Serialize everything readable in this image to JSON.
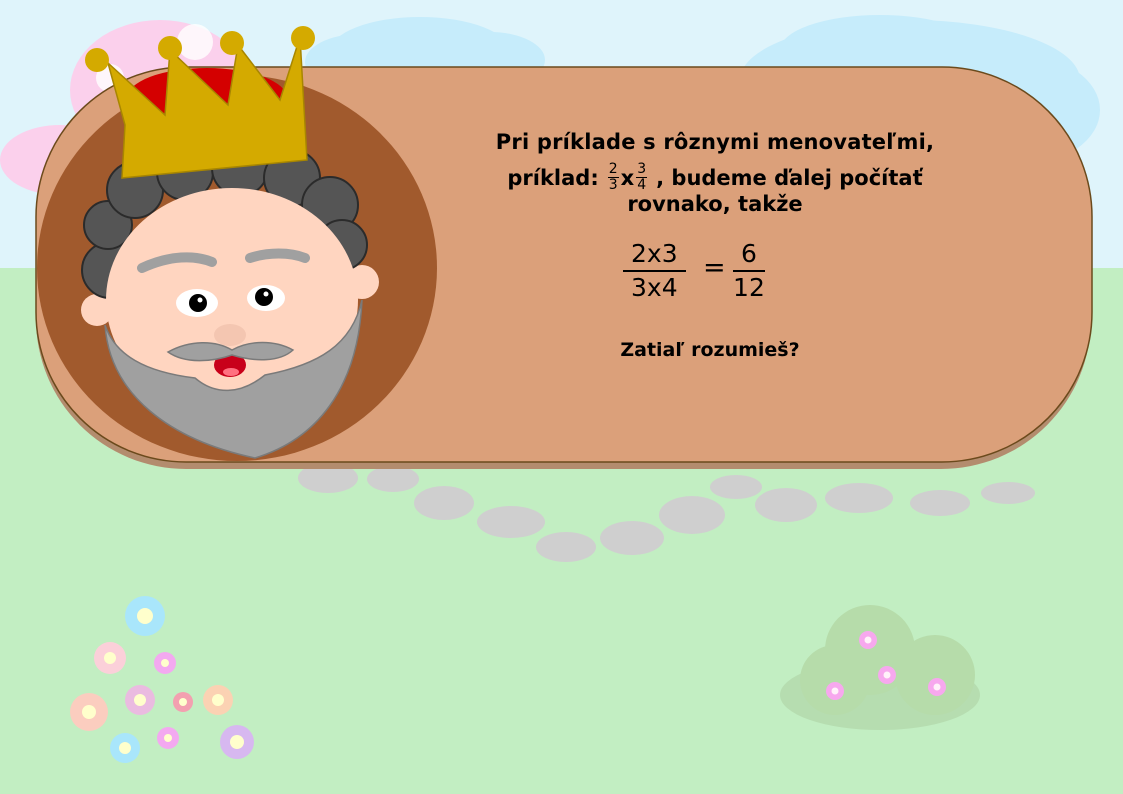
{
  "bubble": {
    "line1": "Pri príklade s rôznymi menovateľmi,",
    "line2_prefix": "príklad:",
    "example_fraction_a": {
      "numerator": "2",
      "denominator": "3"
    },
    "operator": "x",
    "example_fraction_b": {
      "numerator": "3",
      "denominator": "4"
    },
    "line2_suffix": ", budeme ďalej počítať",
    "line3": "rovnako, takže",
    "equation": {
      "left": {
        "numerator": "2x3",
        "denominator": "3x4"
      },
      "equals": "=",
      "right": {
        "numerator": "6",
        "denominator": "12"
      }
    },
    "question": "Zatiaľ rozumieš?"
  },
  "colors": {
    "sky": "#dff4fb",
    "grass": "#c2eec2",
    "bubble": "#dba07a",
    "bubble_shadow": "#b38c6e",
    "medallion": "#a15a2d",
    "crown": "#d4aa00",
    "crown_velvet": "#d40000",
    "hair": "#555555",
    "beard": "#a0a0a0",
    "skin": "#ffd5c0"
  },
  "icons": [
    "king-icon",
    "crown-icon",
    "cloud-icon",
    "flower-icon",
    "bush-icon",
    "stepping-stone-icon"
  ]
}
